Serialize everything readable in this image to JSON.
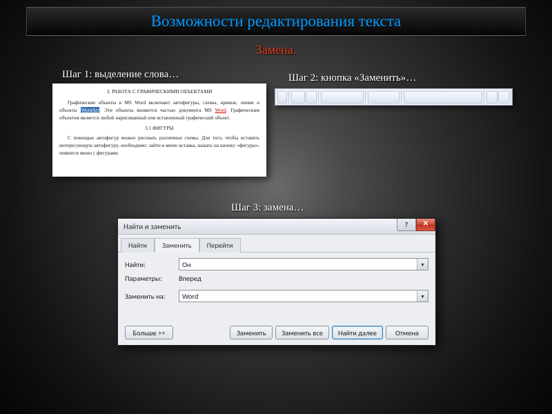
{
  "title": "Возможности редактирования текста",
  "subtitle": "Замена.",
  "steps": {
    "s1": "Шаг 1: выделение слова…",
    "s2": "Шаг 2: кнопка «Заменить»…",
    "s3": "Шаг 3: замена…"
  },
  "doc": {
    "h1": "3. РАБОТА С ГРАФИЧЕСКИМИ ОБЪЕКТАМИ",
    "p1a": "Графические объекты в MS Word включают автофигуры, схемы, кривые, линии и объекты ",
    "p1_sel": "WordArt",
    "p1b": ". Эти объекты являются частью документа MS ",
    "p1_u": "Word",
    "p1c": ". Графическим объектом является любой нарисованный или вставленный графический объект.",
    "h2": "3.1 ФИГУРЫ",
    "p2": "С помощью автофигур можно рисовать различные схемы. Для того, чтобы вставить интересующую автофигуру, необходимо: зайти в меню вставка, нажать на кнопку «фигуры», появится меню с фигурами."
  },
  "dialog": {
    "title": "Найти и заменить",
    "tabs": {
      "find": "Найти",
      "replace": "Заменить",
      "goto": "Перейти"
    },
    "labels": {
      "find": "Найти:",
      "params": "Параметры:",
      "params_value": "Вперед",
      "replace_with": "Заменить на:"
    },
    "values": {
      "find": "Он",
      "replace": "Word"
    },
    "buttons": {
      "more": "Больше >>",
      "replace": "Заменить",
      "replace_all": "Заменить все",
      "find_next": "Найти далее",
      "cancel": "Отмена"
    }
  }
}
